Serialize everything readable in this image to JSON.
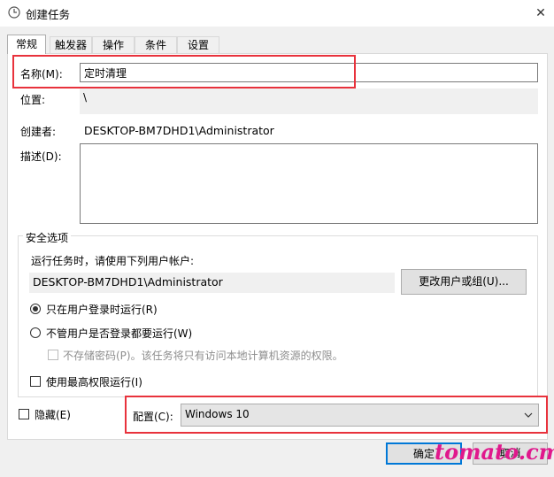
{
  "window": {
    "title": "创建任务",
    "close_glyph": "✕"
  },
  "tabs": [
    {
      "label": "常规",
      "active": true
    },
    {
      "label": "触发器",
      "active": false
    },
    {
      "label": "操作",
      "active": false
    },
    {
      "label": "条件",
      "active": false
    },
    {
      "label": "设置",
      "active": false
    }
  ],
  "general": {
    "name_label": "名称(M):",
    "name_value": "定时清理",
    "location_label": "位置:",
    "location_value": "\\",
    "author_label": "创建者:",
    "author_value": "DESKTOP-BM7DHD1\\Administrator",
    "description_label": "描述(D):",
    "description_value": ""
  },
  "security": {
    "group_label": "安全选项",
    "run_as_prompt": "运行任务时，请使用下列用户帐户:",
    "run_as_account": "DESKTOP-BM7DHD1\\Administrator",
    "change_user_button": "更改用户或组(U)...",
    "radio_logged_on": "只在用户登录时运行(R)",
    "radio_logged_on_selected": true,
    "radio_any": "不管用户是否登录都要运行(W)",
    "no_store_password": "不存储密码(P)。该任务将只有访问本地计算机资源的权限。",
    "highest_privileges": "使用最高权限运行(I)"
  },
  "bottom": {
    "hidden_label": "隐藏(E)",
    "configure_label": "配置(C):",
    "configure_value": "Windows 10",
    "ok_button": "确定",
    "cancel_button": "取消"
  },
  "watermark": "tomato.cm",
  "colors": {
    "highlight": "#e8323c",
    "watermark": "#e0188c",
    "focus": "#0078d7"
  }
}
